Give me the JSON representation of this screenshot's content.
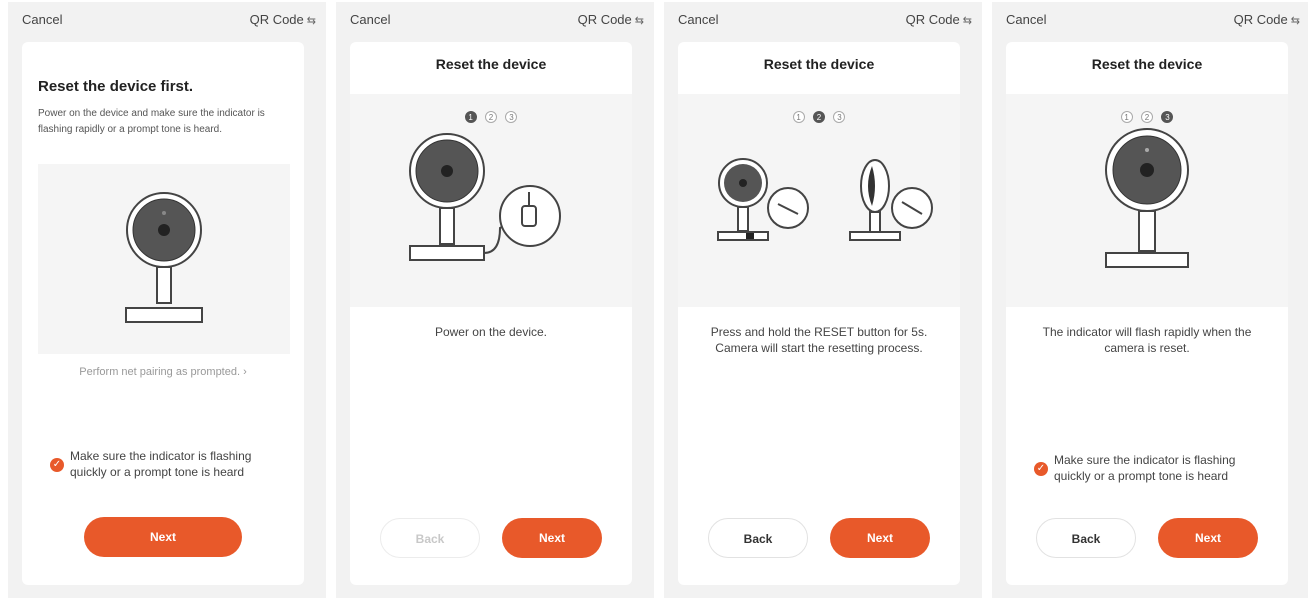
{
  "common": {
    "cancel": "Cancel",
    "qr_code": "QR Code",
    "swap_glyph": "⇆",
    "check_glyph": "✓",
    "confirm_text": "Make sure the indicator is flashing quickly or a prompt tone is heard",
    "next": "Next",
    "back": "Back"
  },
  "screen1": {
    "title": "Reset the device first.",
    "description": "Power on the device and make sure the indicator is flashing rapidly or a prompt tone is heard.",
    "help_link": "Perform net pairing as prompted. ›"
  },
  "screen2": {
    "title": "Reset the device",
    "steps": [
      "1",
      "2",
      "3"
    ],
    "active_step": 1,
    "description": "Power on the device."
  },
  "screen3": {
    "title": "Reset the device",
    "steps": [
      "1",
      "2",
      "3"
    ],
    "active_step": 2,
    "description": "Press and hold the RESET button for 5s. Camera will start the resetting process."
  },
  "screen4": {
    "title": "Reset the device",
    "steps": [
      "1",
      "2",
      "3"
    ],
    "active_step": 3,
    "description": "The indicator will flash rapidly when the camera is reset."
  },
  "colors": {
    "accent": "#e8592a",
    "card": "#ffffff",
    "background": "#f2f2f2",
    "illustration_panel": "#f5f5f5"
  },
  "icons": {
    "swap": "swap-arrows-icon",
    "check": "check-circle-icon"
  }
}
